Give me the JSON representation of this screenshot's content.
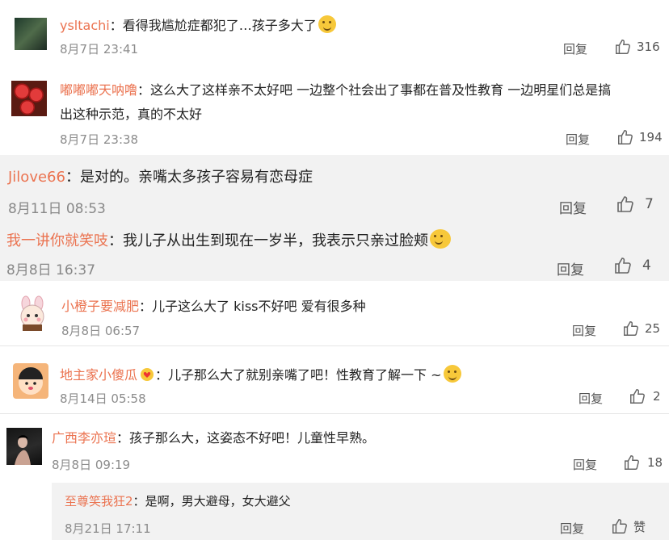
{
  "comments": [
    {
      "name": "ysltachi",
      "sep": "：",
      "text": "看得我尴尬症都犯了…孩子多大了",
      "time": "8月7日 23:41",
      "reply": "回复",
      "likes": "316",
      "emoji": "sweat-smile-emoji"
    },
    {
      "name": "嘟嘟嘟天呐噜",
      "sep": "：",
      "text": "这么大了这样亲不太好吧 一边整个社会出了事都在普及性教育 一边明星们总是搞",
      "text2": "出这种示范，真的不太好",
      "time": "8月7日 23:38",
      "reply": "回复",
      "likes": "194"
    },
    {
      "name": "Jilove66",
      "sep": "：",
      "text": "是对的。亲嘴太多孩子容易有恋母症",
      "time": "8月11日 08:53",
      "reply": "回复",
      "likes": "7"
    },
    {
      "name": "我一讲你就笑吱",
      "sep": "：",
      "text": "我儿子从出生到现在一岁半，我表示只亲过脸颊",
      "time": "8月8日 16:37",
      "reply": "回复",
      "likes": "4",
      "emoji": "laughing-tears-emoji"
    },
    {
      "name": "小橙子要减肥",
      "sep": "：",
      "text": "儿子这么大了 kiss不好吧 爱有很多种",
      "time": "8月8日 06:57",
      "reply": "回复",
      "likes": "25"
    },
    {
      "name": "地主家小傻瓜",
      "sep": "：",
      "text": "儿子那么大了就别亲嘴了吧！性教育了解一下 ~",
      "time": "8月14日 05:58",
      "reply": "回复",
      "likes": "2",
      "emoji": "yum-emoji"
    },
    {
      "name": "广西李亦瑄",
      "sep": "：",
      "text": "孩子那么大，这姿态不好吧！儿童性早熟。",
      "time": "8月8日 09:19",
      "reply": "回复",
      "likes": "18"
    },
    {
      "name": "至尊笑我狂2",
      "sep": "：",
      "text": "是啊，男大避母，女大避父",
      "time": "8月21日 17:11",
      "reply": "回复",
      "likes": "赞"
    }
  ],
  "colors": {
    "name": "#eb7350",
    "meta": "#8c8c8c",
    "bg_gray": "#f2f2f2"
  }
}
